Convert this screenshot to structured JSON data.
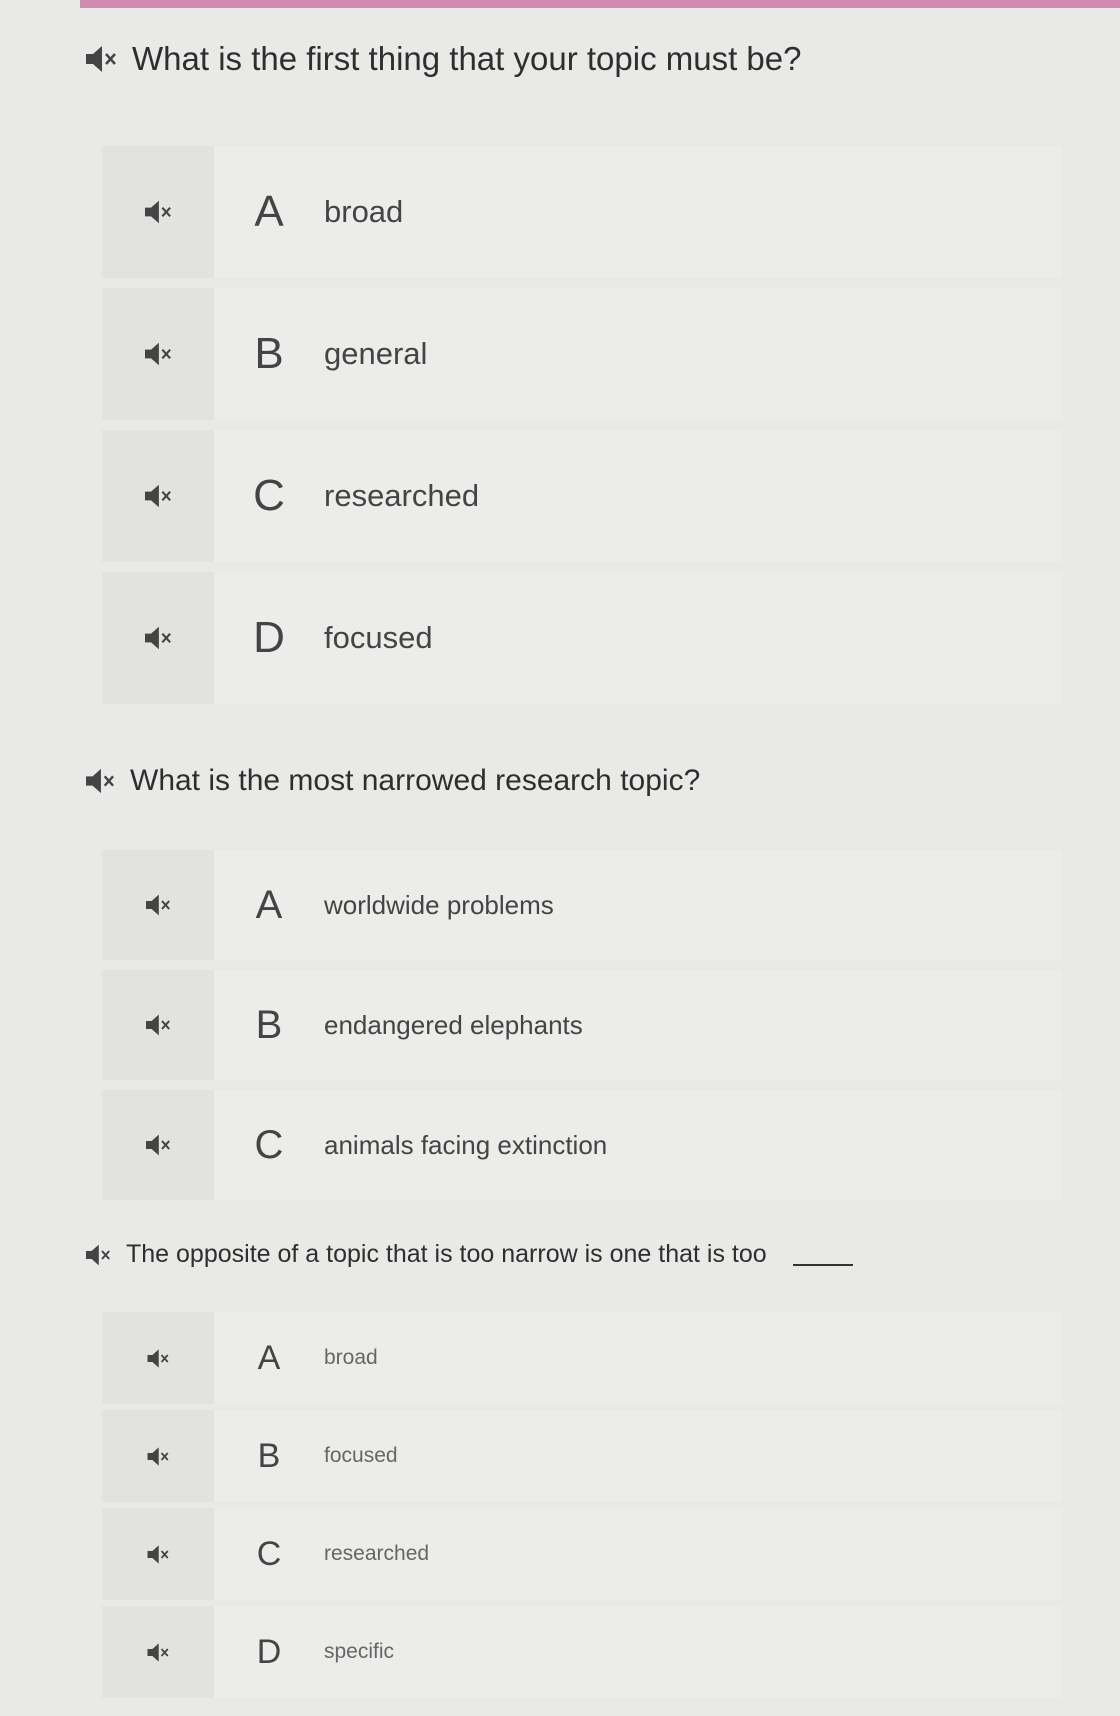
{
  "questions": [
    {
      "prompt": "What is the first thing that your topic must be?",
      "options": [
        {
          "letter": "A",
          "text": "broad"
        },
        {
          "letter": "B",
          "text": "general"
        },
        {
          "letter": "C",
          "text": "researched"
        },
        {
          "letter": "D",
          "text": "focused"
        }
      ]
    },
    {
      "prompt": "What is the most narrowed research topic?",
      "options": [
        {
          "letter": "A",
          "text": "worldwide problems"
        },
        {
          "letter": "B",
          "text": "endangered elephants"
        },
        {
          "letter": "C",
          "text": "animals facing extinction"
        }
      ]
    },
    {
      "prompt": "The opposite of a topic that is too narrow is one that is too",
      "options": [
        {
          "letter": "A",
          "text": "broad"
        },
        {
          "letter": "B",
          "text": "focused"
        },
        {
          "letter": "C",
          "text": "researched"
        },
        {
          "letter": "D",
          "text": "specific"
        }
      ]
    }
  ],
  "icons": {
    "speaker": "speaker-muted-icon"
  },
  "colors": {
    "top_bar": "#cc7aa6"
  }
}
